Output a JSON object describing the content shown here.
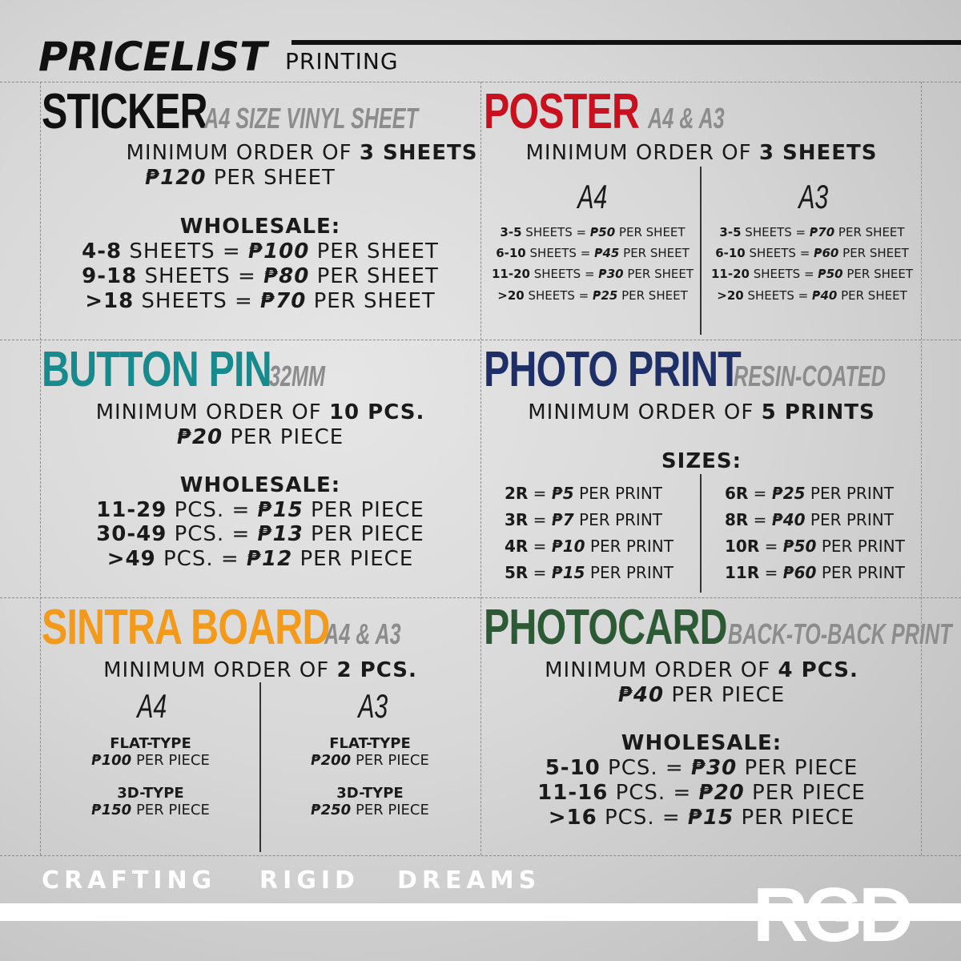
{
  "header": {
    "title": "PRICELIST",
    "subtitle": "PRINTING"
  },
  "colors": {
    "sticker": "#111111",
    "poster": "#c8101e",
    "button_pin": "#168a8c",
    "photo_print": "#1d2f66",
    "sintra_board": "#f39a1b",
    "photocard": "#2c5a35"
  },
  "sticker": {
    "title": "STICKER",
    "subtitle": "A4 SIZE VINYL SHEET",
    "min_prefix": "MINIMUM ORDER OF ",
    "min_value": "3 SHEETS",
    "price_value": "₱120",
    "price_suffix": " PER SHEET",
    "wholesale_label": "WHOLESALE:",
    "wholesale": [
      {
        "qty": "4-8",
        "unit": " SHEETS = ",
        "price": "₱100",
        "suffix": " PER SHEET"
      },
      {
        "qty": "9-18",
        "unit": " SHEETS = ",
        "price": "₱80",
        "suffix": " PER SHEET"
      },
      {
        "qty": ">18",
        "unit": " SHEETS = ",
        "price": "₱70",
        "suffix": " PER SHEET"
      }
    ]
  },
  "poster": {
    "title": "POSTER",
    "subtitle": "A4 & A3",
    "min_prefix": "MINIMUM ORDER OF ",
    "min_value": "3 SHEETS",
    "a4": {
      "label": "A4",
      "rows": [
        {
          "qty": "3-5",
          "unit": " SHEETS = ",
          "price": "₱50",
          "suffix": " PER SHEET"
        },
        {
          "qty": "6-10",
          "unit": " SHEETS = ",
          "price": "₱45",
          "suffix": " PER SHEET"
        },
        {
          "qty": "11-20",
          "unit": " SHEETS = ",
          "price": "₱30",
          "suffix": " PER SHEET"
        },
        {
          "qty": ">20",
          "unit": " SHEETS = ",
          "price": "₱25",
          "suffix": " PER SHEET"
        }
      ]
    },
    "a3": {
      "label": "A3",
      "rows": [
        {
          "qty": "3-5",
          "unit": " SHEETS = ",
          "price": "₱70",
          "suffix": " PER SHEET"
        },
        {
          "qty": "6-10",
          "unit": " SHEETS = ",
          "price": "₱60",
          "suffix": " PER SHEET"
        },
        {
          "qty": "11-20",
          "unit": " SHEETS = ",
          "price": "₱50",
          "suffix": " PER SHEET"
        },
        {
          "qty": ">20",
          "unit": " SHEETS = ",
          "price": "₱40",
          "suffix": " PER SHEET"
        }
      ]
    }
  },
  "button_pin": {
    "title": "BUTTON PIN",
    "subtitle": "32MM",
    "min_prefix": "MINIMUM ORDER OF ",
    "min_value": "10 PCS.",
    "price_value": "₱20",
    "price_suffix": " PER PIECE",
    "wholesale_label": "WHOLESALE:",
    "wholesale": [
      {
        "qty": "11-29",
        "unit": " PCS. = ",
        "price": "₱15",
        "suffix": " PER PIECE"
      },
      {
        "qty": "30-49",
        "unit": " PCS. = ",
        "price": "₱13",
        "suffix": " PER PIECE"
      },
      {
        "qty": ">49",
        "unit": " PCS. = ",
        "price": "₱12",
        "suffix": " PER PIECE"
      }
    ]
  },
  "photo_print": {
    "title": "PHOTO PRINT",
    "subtitle": "RESIN-COATED",
    "min_prefix": "MINIMUM ORDER OF ",
    "min_value": "5 PRINTS",
    "sizes_label": "SIZES:",
    "left": [
      {
        "size": "2R",
        "price": "₱5",
        "suffix": " PER PRINT"
      },
      {
        "size": "3R",
        "price": "₱7",
        "suffix": " PER PRINT"
      },
      {
        "size": "4R",
        "price": "₱10",
        "suffix": " PER PRINT"
      },
      {
        "size": "5R",
        "price": "₱15",
        "suffix": " PER PRINT"
      }
    ],
    "right": [
      {
        "size": "6R",
        "price": "₱25",
        "suffix": " PER PRINT"
      },
      {
        "size": "8R",
        "price": "₱40",
        "suffix": " PER PRINT"
      },
      {
        "size": "10R",
        "price": "₱50",
        "suffix": " PER PRINT"
      },
      {
        "size": "11R",
        "price": "₱60",
        "suffix": " PER PRINT"
      }
    ]
  },
  "sintra_board": {
    "title": "SINTRA BOARD",
    "subtitle": "A4 & A3",
    "min_prefix": "MINIMUM ORDER OF ",
    "min_value": "2 PCS.",
    "a4": {
      "label": "A4",
      "items": [
        {
          "type": "FLAT-TYPE",
          "price": "₱100",
          "suffix": " PER PIECE"
        },
        {
          "type": "3D-TYPE",
          "price": "₱150",
          "suffix": " PER PIECE"
        }
      ]
    },
    "a3": {
      "label": "A3",
      "items": [
        {
          "type": "FLAT-TYPE",
          "price": "₱200",
          "suffix": " PER PIECE"
        },
        {
          "type": "3D-TYPE",
          "price": "₱250",
          "suffix": " PER PIECE"
        }
      ]
    }
  },
  "photocard": {
    "title": "PHOTOCARD",
    "subtitle": "BACK-TO-BACK PRINT",
    "min_prefix": "MINIMUM ORDER OF ",
    "min_value": "4 PCS.",
    "price_value": "₱40",
    "price_suffix": " PER PIECE",
    "wholesale_label": "WHOLESALE:",
    "wholesale": [
      {
        "qty": "5-10",
        "unit": " PCS. = ",
        "price": "₱30",
        "suffix": " PER PIECE"
      },
      {
        "qty": "11-16",
        "unit": " PCS. = ",
        "price": "₱20",
        "suffix": " PER PIECE"
      },
      {
        "qty": ">16",
        "unit": " PCS. = ",
        "price": "₱15",
        "suffix": " PER PIECE"
      }
    ]
  },
  "footer": {
    "words": [
      "CRAFTING",
      "RIGID",
      "DREAMS"
    ],
    "logo": "RGD"
  }
}
